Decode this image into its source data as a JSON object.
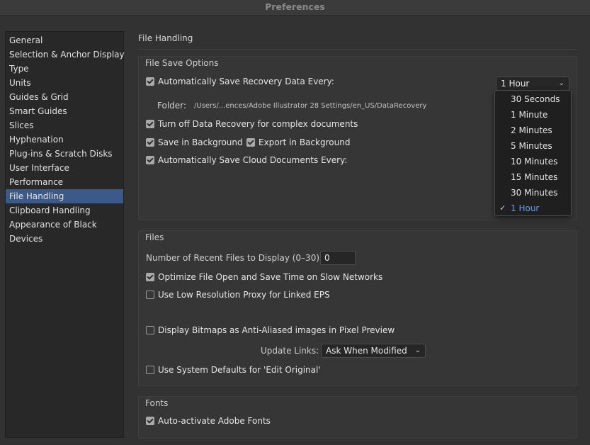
{
  "window": {
    "title": "Preferences"
  },
  "sidebar": {
    "items": [
      {
        "label": "General"
      },
      {
        "label": "Selection & Anchor Display"
      },
      {
        "label": "Type"
      },
      {
        "label": "Units"
      },
      {
        "label": "Guides & Grid"
      },
      {
        "label": "Smart Guides"
      },
      {
        "label": "Slices"
      },
      {
        "label": "Hyphenation"
      },
      {
        "label": "Plug-ins & Scratch Disks"
      },
      {
        "label": "User Interface"
      },
      {
        "label": "Performance"
      },
      {
        "label": "File Handling",
        "selected": true
      },
      {
        "label": "Clipboard Handling"
      },
      {
        "label": "Appearance of Black"
      },
      {
        "label": "Devices"
      }
    ]
  },
  "main": {
    "title": "File Handling",
    "file_save_options": {
      "title": "File Save Options",
      "auto_save": {
        "label": "Automatically Save Recovery Data Every:",
        "checked": true
      },
      "interval_select": {
        "value": "1 Hour"
      },
      "folder_label": "Folder:",
      "folder_path": "/Users/...ences/Adobe Illustrator 28 Settings/en_US/DataRecovery",
      "turn_off_recovery": {
        "label": "Turn off Data Recovery for complex documents",
        "checked": true
      },
      "save_in_background": {
        "label": "Save in Background",
        "checked": true
      },
      "export_in_background": {
        "label": "Export in Background",
        "checked": true
      },
      "auto_save_cloud": {
        "label": "Automatically Save Cloud Documents Every:",
        "checked": true
      }
    },
    "interval_dropdown": {
      "options": [
        "30 Seconds",
        "1 Minute",
        "2 Minutes",
        "5 Minutes",
        "10 Minutes",
        "15 Minutes",
        "30 Minutes",
        "1 Hour"
      ],
      "selected": "1 Hour",
      "check_glyph": "✓"
    },
    "files": {
      "title": "Files",
      "recent_files_label": "Number of Recent Files to Display (0–30):",
      "recent_files_value": "0",
      "optimize": {
        "label": "Optimize File Open and Save Time on Slow Networks",
        "checked": true
      },
      "low_res_proxy": {
        "label": "Use Low Resolution Proxy for Linked EPS",
        "checked": false
      },
      "anti_aliased": {
        "label": "Display Bitmaps as Anti-Aliased images in Pixel Preview",
        "checked": false
      },
      "update_links_label": "Update Links:",
      "update_links_value": "Ask When Modified",
      "system_defaults": {
        "label": "Use System Defaults for 'Edit Original'",
        "checked": false
      }
    },
    "fonts": {
      "title": "Fonts",
      "auto_activate": {
        "label": "Auto-activate Adobe Fonts",
        "checked": true
      }
    }
  },
  "colors": {
    "selection": "#3b5a8a",
    "dropdown_selected": "#5aa0ff"
  }
}
